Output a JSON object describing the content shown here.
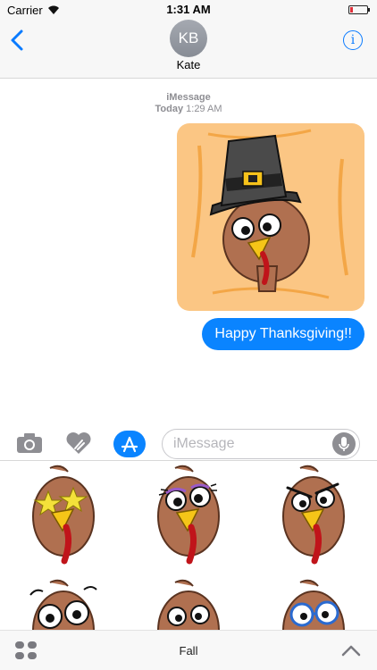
{
  "status_bar": {
    "carrier": "Carrier",
    "time": "1:31 AM",
    "battery_level": 0.15
  },
  "header": {
    "avatar_initials": "KB",
    "contact_name": "Kate"
  },
  "conversation": {
    "service": "iMessage",
    "day": "Today",
    "time": "1:29 AM",
    "sent_message": "Happy Thanksgiving!!"
  },
  "composer": {
    "placeholder": "iMessage"
  },
  "sticker_drawer": {
    "stickers": [
      {
        "name": "turkey-star-eyes-sticker"
      },
      {
        "name": "turkey-lashes-sticker"
      },
      {
        "name": "turkey-angry-sticker"
      },
      {
        "name": "turkey-wide-eyes-sticker"
      },
      {
        "name": "turkey-surprised-sticker"
      },
      {
        "name": "turkey-glasses-sticker"
      }
    ]
  },
  "bottom_bar": {
    "pack_name": "Fall"
  },
  "colors": {
    "accent": "#0a84ff",
    "sticker_bg": "#fbc684",
    "turkey": "#b07050",
    "beak": "#f5c518",
    "wattle": "#c0141a"
  }
}
